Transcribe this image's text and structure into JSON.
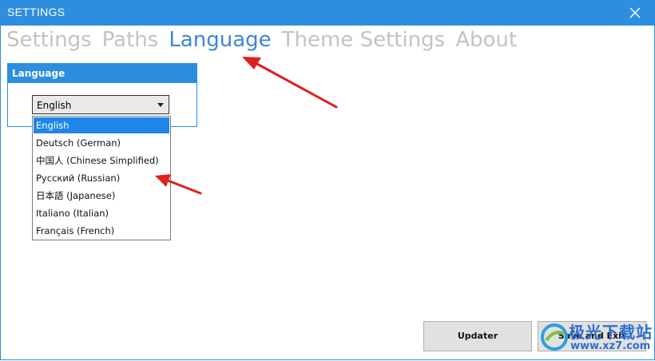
{
  "window": {
    "title": "SETTINGS",
    "close_icon": "close-icon",
    "accent_color": "#2d8ee0"
  },
  "tabs": [
    {
      "label": "Settings",
      "active": false
    },
    {
      "label": "Paths",
      "active": false
    },
    {
      "label": "Language",
      "active": true
    },
    {
      "label": "Theme Settings",
      "active": false
    },
    {
      "label": "About",
      "active": false
    }
  ],
  "language_group": {
    "header": "Language",
    "selected_value": "English",
    "options": [
      "English",
      "Deutsch (German)",
      "中国人 (Chinese Simplified)",
      "Русский (Russian)",
      "日本語 (Japanese)",
      "Italiano (Italian)",
      "Français (French)"
    ]
  },
  "buttons": {
    "updater": "Updater",
    "save_exit": "Save and Exit"
  },
  "annotation_color": "#e02020",
  "watermark": {
    "text": "极光下载站",
    "url": "www.xz7.com"
  }
}
